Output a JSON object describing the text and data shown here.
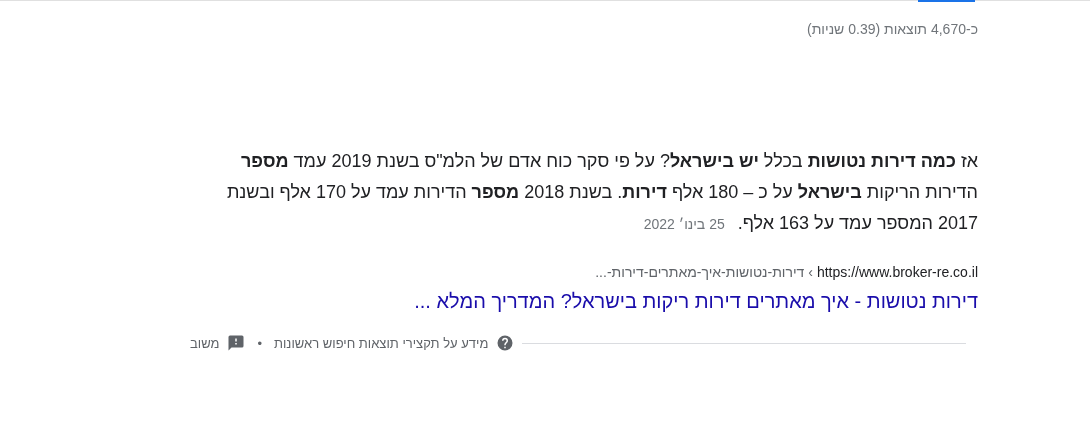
{
  "result_stats": "כ-4,670 תוצאות (0.39 שניות)",
  "featured_snippet": {
    "text": "אז **כמה דירות נטושות** בכלל **יש בישראל**? על פי סקר כוח אדם של הלמ\"ס בשנת 2019 עמד **מספר** הדירות הריקות **בישראל** על כ – 180 אלף **דירות**. בשנת 2018 **מספר** הדירות עמד על 170 אלף ובשנת 2017 המספר עמד על 163 אלף.",
    "date": "25 בינו׳ 2022",
    "url": "https://www.broker-re.co.il",
    "breadcrumb": "› דירות-נטושות-איך-מאתרים-דירות-...",
    "title": "דירות נטושות - איך מאתרים דירות ריקות בישראל? המדריך המלא ..."
  },
  "footer": {
    "about_link": "מידע על תקצירי תוצאות חיפוש ראשונות",
    "separator": "•",
    "feedback_link": "משוב"
  }
}
